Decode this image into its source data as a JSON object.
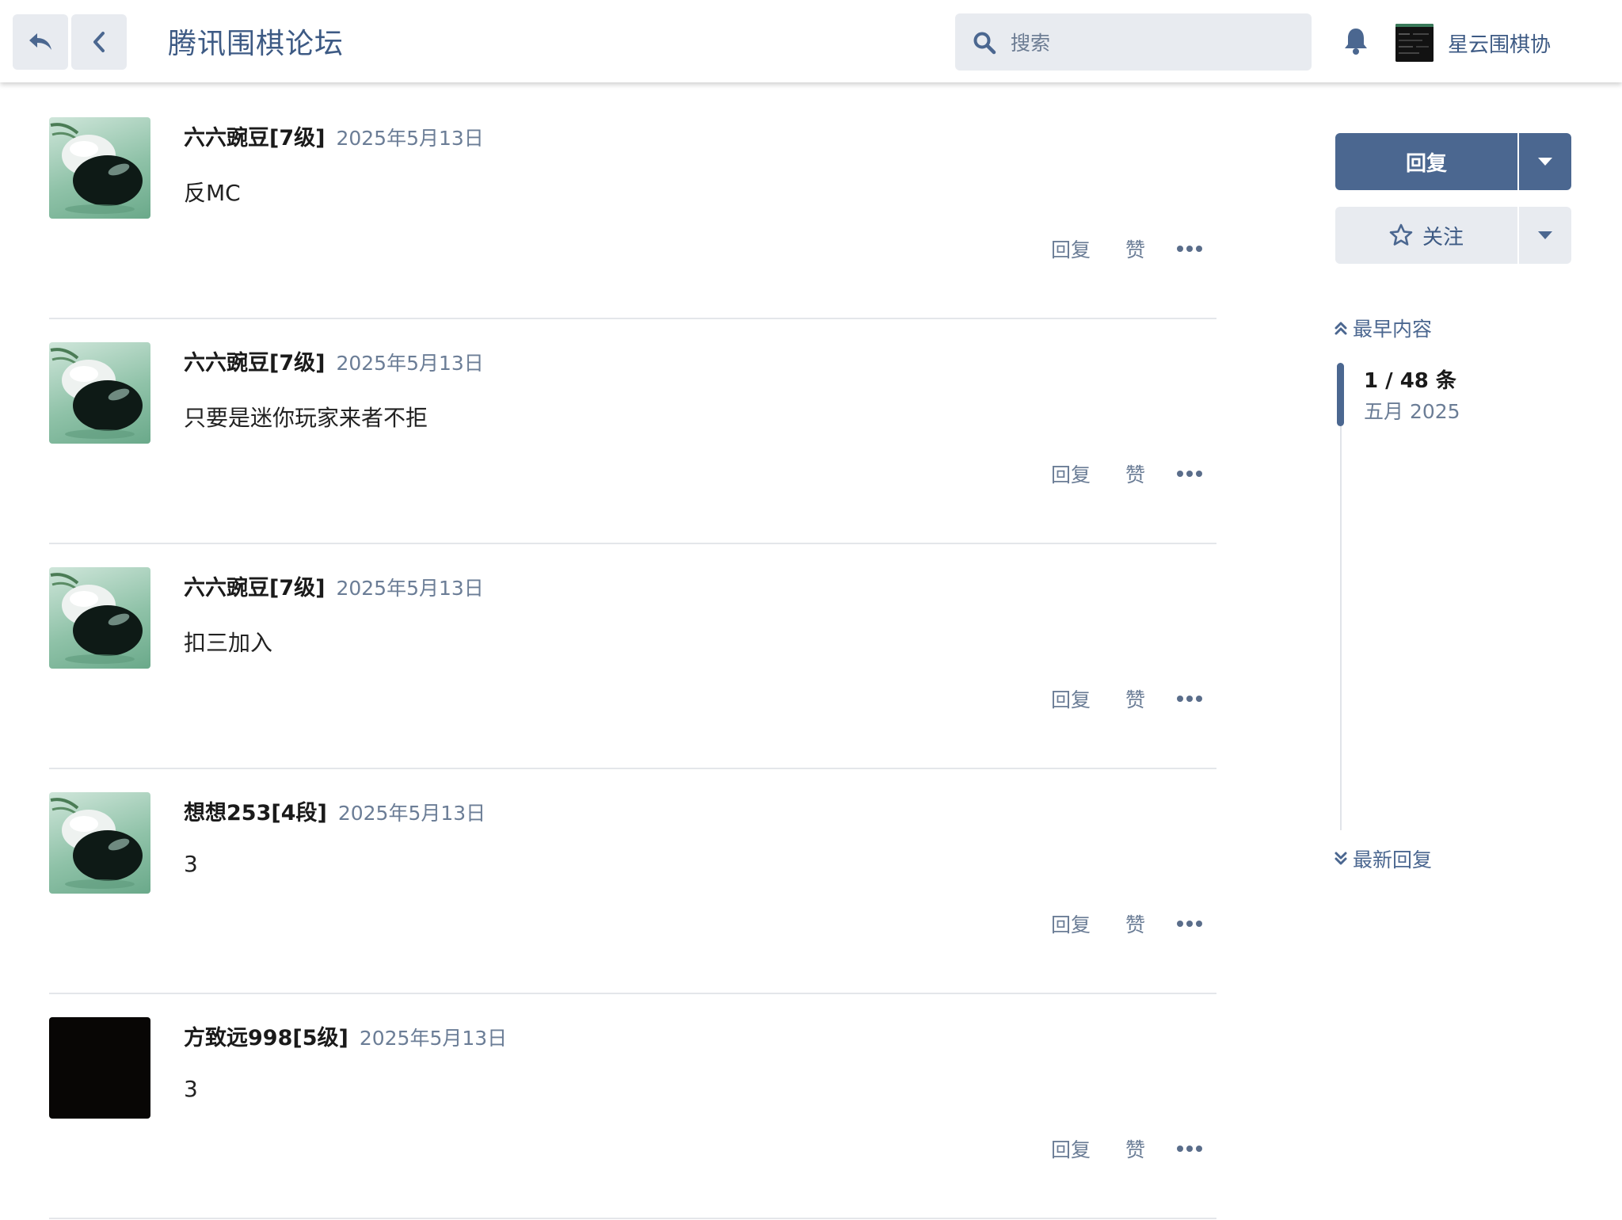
{
  "header": {
    "title": "腾讯围棋论坛",
    "search_placeholder": "搜索",
    "username": "星云围棋协"
  },
  "posts": [
    {
      "author": "六六豌豆[7级]",
      "date": "2025年5月13日",
      "content": "反MC",
      "reply_label": "回复",
      "like_label": "赞",
      "avatar": "go-stones"
    },
    {
      "author": "六六豌豆[7级]",
      "date": "2025年5月13日",
      "content": "只要是迷你玩家来者不拒",
      "reply_label": "回复",
      "like_label": "赞",
      "avatar": "go-stones"
    },
    {
      "author": "六六豌豆[7级]",
      "date": "2025年5月13日",
      "content": "扣三加入",
      "reply_label": "回复",
      "like_label": "赞",
      "avatar": "go-stones"
    },
    {
      "author": "想想253[4段]",
      "date": "2025年5月13日",
      "content": "3",
      "reply_label": "回复",
      "like_label": "赞",
      "avatar": "go-stones"
    },
    {
      "author": "方致远998[5级]",
      "date": "2025年5月13日",
      "content": "3",
      "reply_label": "回复",
      "like_label": "赞",
      "avatar": "black-square"
    }
  ],
  "sidebar": {
    "reply_button": "回复",
    "follow_button": "关注",
    "earliest_label": "最早内容",
    "latest_label": "最新回复",
    "position": "1 / 48 条",
    "position_date": "五月 2025"
  },
  "colors": {
    "accent": "#4b6790",
    "link": "#3d5a84",
    "muted": "#6b7d96",
    "divider": "#e4e6ea",
    "button_bg": "#e8ebf0"
  }
}
